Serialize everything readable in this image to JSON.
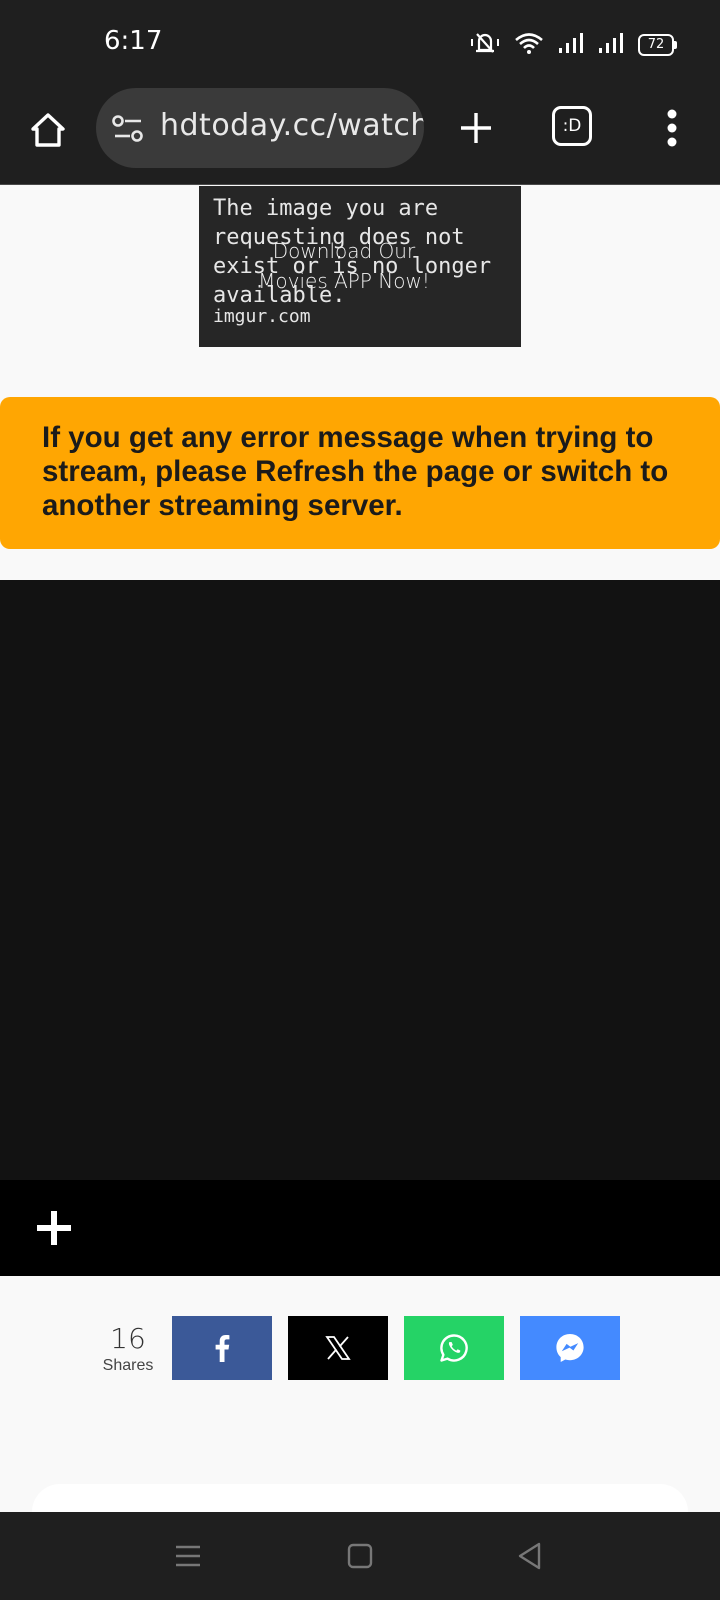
{
  "status_bar": {
    "time": "6:17",
    "battery": "72"
  },
  "browser": {
    "url": "hdtoday.cc/watch",
    "tabs_label": ":D"
  },
  "image_banner": {
    "message": "The image you are requesting does not exist or is no longer available.",
    "source": "imgur.com",
    "alt_text": "Download Our Movies APP Now!"
  },
  "warning": {
    "text": "If you get any error message when trying to stream, please Refresh the page or switch to another streaming server.",
    "color": "#ffa602"
  },
  "share": {
    "count": "16",
    "label": "Shares",
    "buttons": [
      {
        "network": "facebook",
        "icon": "facebook-icon",
        "color": "#3b5998"
      },
      {
        "network": "x",
        "icon": "x-icon",
        "color": "#000000"
      },
      {
        "network": "whatsapp",
        "icon": "whatsapp-icon",
        "color": "#25d366"
      },
      {
        "network": "messenger",
        "icon": "messenger-icon",
        "color": "#448aff"
      }
    ]
  }
}
